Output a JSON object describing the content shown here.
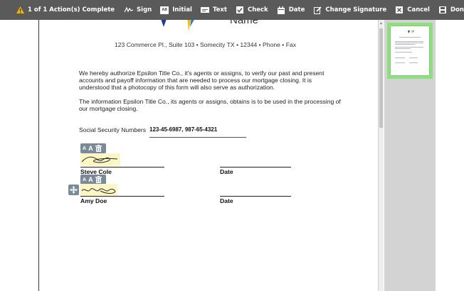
{
  "toolbar": {
    "status": "1 of 1 Action(s) Complete",
    "sign_label": "Sign",
    "initial_label": "Initial",
    "text_label": "Text",
    "check_label": "Check",
    "date_label": "Date",
    "change_signature_label": "Change Signature",
    "cancel_label": "Cancel",
    "done_label": "Done"
  },
  "document": {
    "header_name": "Name",
    "address": "123 Commerce Pl., Suite 103 • Somecity  TX  • 12344 • Phone  • Fax",
    "paragraph_1": "We hereby authorize Epsilon Title Co., it's agents or assigns, to verify our past and present accounts and payoff information that are needed to process our mortgage closing.  It is understood that a photocopy of this form will also serve as authorization.",
    "paragraph_2": "The information Epsilon Title Co., its agents or assigns, obtains is to be used in the processing of our mortgage closing.",
    "ssn_label": "Social Security Numbers",
    "ssn_value": "123-45-6987, 987-65-4321",
    "signers": [
      {
        "name": "Steve Cole",
        "date_label": "Date"
      },
      {
        "name": "Amy Doe",
        "date_label": "Date"
      }
    ]
  },
  "signature_tools": {
    "small_a": "A",
    "large_a": "A"
  },
  "colors": {
    "toolbar_bg": "#5a5a5a",
    "warning_icon": "#f0b400",
    "thumbnail_highlight": "#8ee07f",
    "signature_highlight": "#fbf6c4",
    "tool_bg": "#7a8a9a"
  }
}
